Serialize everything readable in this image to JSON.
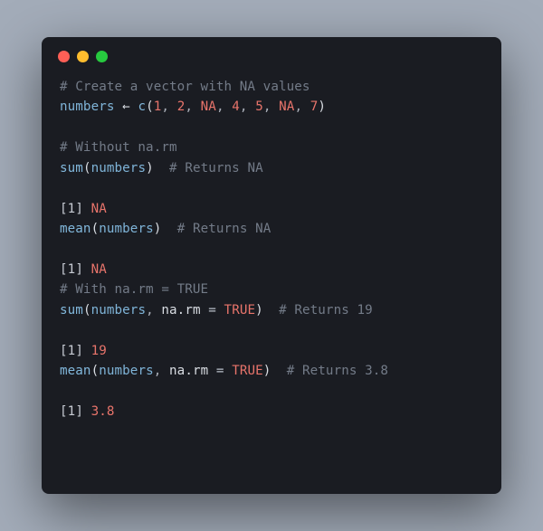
{
  "titlebar": {
    "dots": [
      "red",
      "yellow",
      "green"
    ]
  },
  "code": {
    "line1_comment": "# Create a vector with NA values",
    "l2_ident": "numbers",
    "l2_assign": " ← ",
    "l2_func": "c",
    "l2_open": "(",
    "l2_v1": "1",
    "l2_c1": ", ",
    "l2_v2": "2",
    "l2_c2": ", ",
    "l2_na1": "NA",
    "l2_c3": ", ",
    "l2_v4": "4",
    "l2_c4": ", ",
    "l2_v5": "5",
    "l2_c5": ", ",
    "l2_na2": "NA",
    "l2_c6": ", ",
    "l2_v7": "7",
    "l2_close": ")",
    "blank": "",
    "l4_comment": "# Without na.rm",
    "l5_func": "sum",
    "l5_open": "(",
    "l5_arg": "numbers",
    "l5_close": ")",
    "l5_pad": "  ",
    "l5_comment": "# Returns NA",
    "l7_out_open": "[",
    "l7_out_idx": "1",
    "l7_out_close": "] ",
    "l7_out_val": "NA",
    "l8_func": "mean",
    "l8_open": "(",
    "l8_arg": "numbers",
    "l8_close": ")",
    "l8_pad": "  ",
    "l8_comment": "# Returns NA",
    "l10_out_open": "[",
    "l10_out_idx": "1",
    "l10_out_close": "] ",
    "l10_out_val": "NA",
    "l11_comment": "# With na.rm = TRUE",
    "l12_func": "sum",
    "l12_open": "(",
    "l12_arg1": "numbers",
    "l12_c1": ", ",
    "l12_arg2": "na.rm",
    "l12_eq": " = ",
    "l12_true": "TRUE",
    "l12_close": ")",
    "l12_pad": "  ",
    "l12_comment": "# Returns 19",
    "l14_out_open": "[",
    "l14_out_idx": "1",
    "l14_out_close": "] ",
    "l14_out_val": "19",
    "l15_func": "mean",
    "l15_open": "(",
    "l15_arg1": "numbers",
    "l15_c1": ", ",
    "l15_arg2": "na.rm",
    "l15_eq": " = ",
    "l15_true": "TRUE",
    "l15_close": ")",
    "l15_pad": "  ",
    "l15_comment": "# Returns 3.8",
    "l17_out_open": "[",
    "l17_out_idx": "1",
    "l17_out_close": "] ",
    "l17_out_val": "3.8"
  }
}
